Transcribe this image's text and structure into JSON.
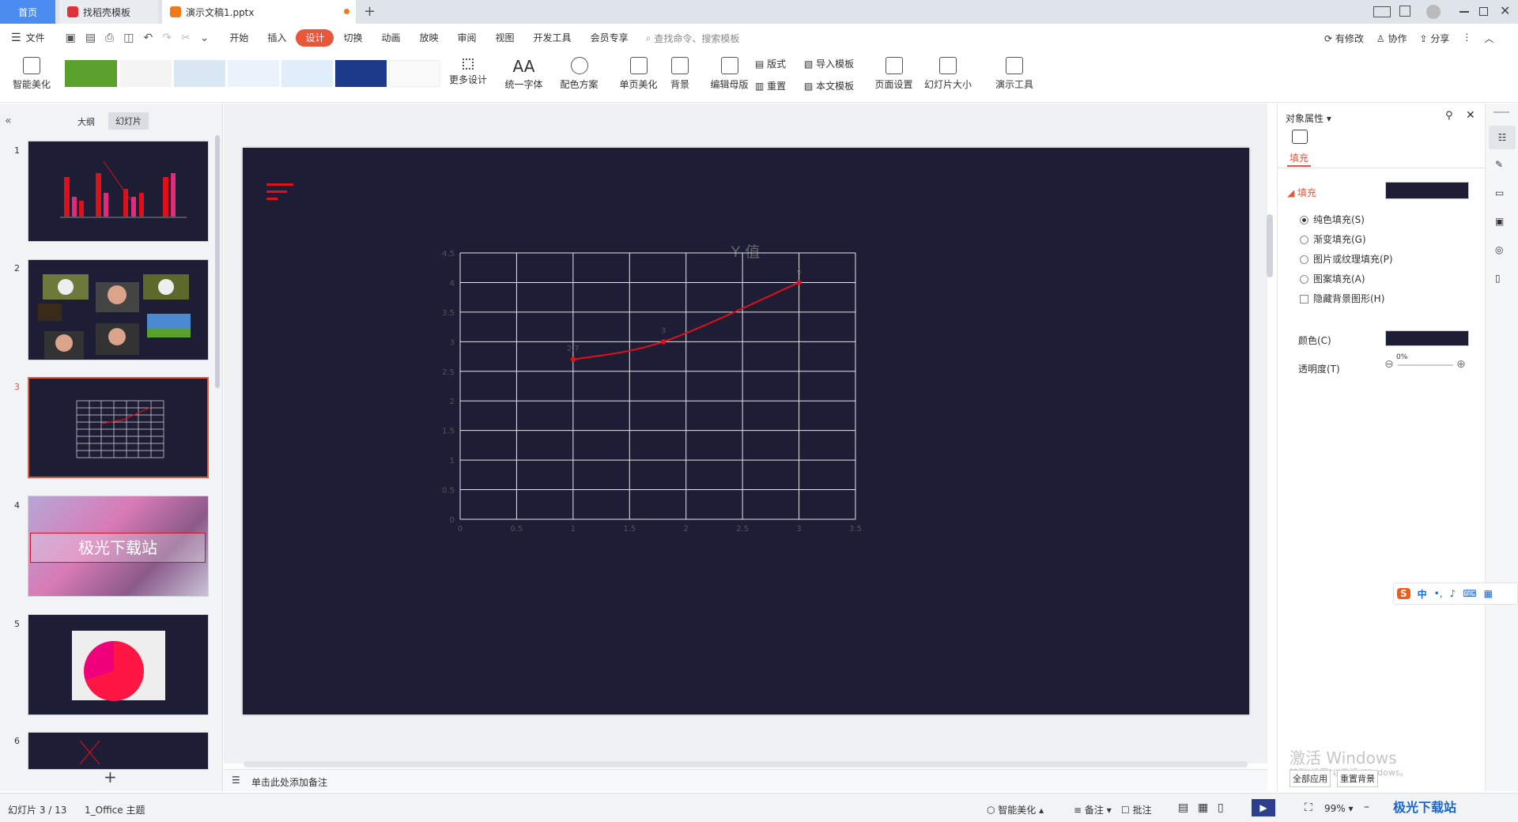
{
  "titlebar": {
    "tab_home": "首页",
    "tab_template": "找稻壳模板",
    "tab_doc": "演示文稿1.pptx",
    "new_tab": "+"
  },
  "menubar": {
    "file": "文件",
    "items": [
      "开始",
      "插入",
      "设计",
      "切换",
      "动画",
      "放映",
      "审阅",
      "视图",
      "开发工具",
      "会员专享"
    ],
    "active": "设计",
    "search_placeholder": "查找命令、搜索模板",
    "modified": "有修改",
    "collab": "协作",
    "share": "分享"
  },
  "ribbon": {
    "smart_beautify": "智能美化",
    "more_design": "更多设计",
    "unify_font": "统一字体",
    "color_scheme": "配色方案",
    "single_page_beautify": "单页美化",
    "background": "背景",
    "edit_master": "编辑母版",
    "layout": "版式",
    "reset": "重置",
    "import_template": "导入模板",
    "this_template": "本文模板",
    "page_setup": "页面设置",
    "slide_size": "幻灯片大小",
    "present_tools": "演示工具"
  },
  "leftpanel": {
    "outline": "大纲",
    "slides": "幻灯片",
    "numbers": [
      "1",
      "2",
      "3",
      "4",
      "5",
      "6"
    ],
    "slide4_text": "极光下载站",
    "add": "+"
  },
  "notes_placeholder": "单击此处添加备注",
  "chart_data": {
    "type": "line",
    "title": "Y 值",
    "x": [
      1,
      1.8,
      3
    ],
    "values": [
      2.7,
      3,
      4
    ],
    "data_labels": [
      "2.7",
      "3",
      "4"
    ],
    "xlim": [
      0,
      3.5
    ],
    "ylim": [
      0,
      4.5
    ],
    "x_ticks": [
      "0",
      "0.5",
      "1",
      "1.5",
      "2",
      "2.5",
      "3",
      "3.5"
    ],
    "y_ticks": [
      "0",
      "0.5",
      "1",
      "1.5",
      "2",
      "2.5",
      "3",
      "3.5",
      "4",
      "4.5"
    ],
    "grid": true,
    "line_color": "#e0101a"
  },
  "rightpanel": {
    "title": "对象属性",
    "tab_fill": "填充",
    "section_fill": "填充",
    "options": [
      "纯色填充(S)",
      "渐变填充(G)",
      "图片或纹理填充(P)",
      "图案填充(A)"
    ],
    "hide_bg": "隐藏背景图形(H)",
    "color_label": "颜色(C)",
    "transparency_label": "透明度(T)",
    "transparency_value": "0%"
  },
  "watermark": {
    "line1": "激活 Windows",
    "line2": "转到\"设置\"以激活 Windows。",
    "apply_all": "全部应用",
    "reset_bg": "重置背景",
    "logo": "极光下载站"
  },
  "ime": {
    "lang": "中"
  },
  "statusbar": {
    "slide_counter": "幻灯片 3 / 13",
    "theme": "1_Office 主题",
    "smart_beautify": "智能美化",
    "notes": "备注",
    "comments": "批注",
    "zoom": "99%"
  }
}
